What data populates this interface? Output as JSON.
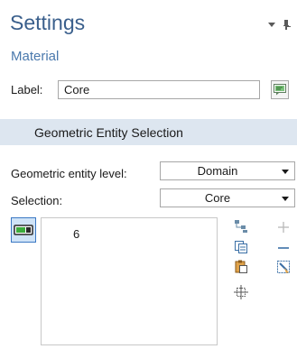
{
  "header": {
    "title": "Settings",
    "subtitle": "Material"
  },
  "label_row": {
    "label": "Label:",
    "value": "Core"
  },
  "section": {
    "title": "Geometric Entity Selection"
  },
  "entity_level": {
    "label": "Geometric entity level:",
    "value": "Domain"
  },
  "selection": {
    "label": "Selection:",
    "value": "Core"
  },
  "selection_list": {
    "items": [
      "6"
    ]
  },
  "colors": {
    "title": "#3a5f8c",
    "section_bg": "#dde6f0",
    "toggle_bg": "#cfe3f7",
    "toggle_border": "#3b78c4"
  }
}
